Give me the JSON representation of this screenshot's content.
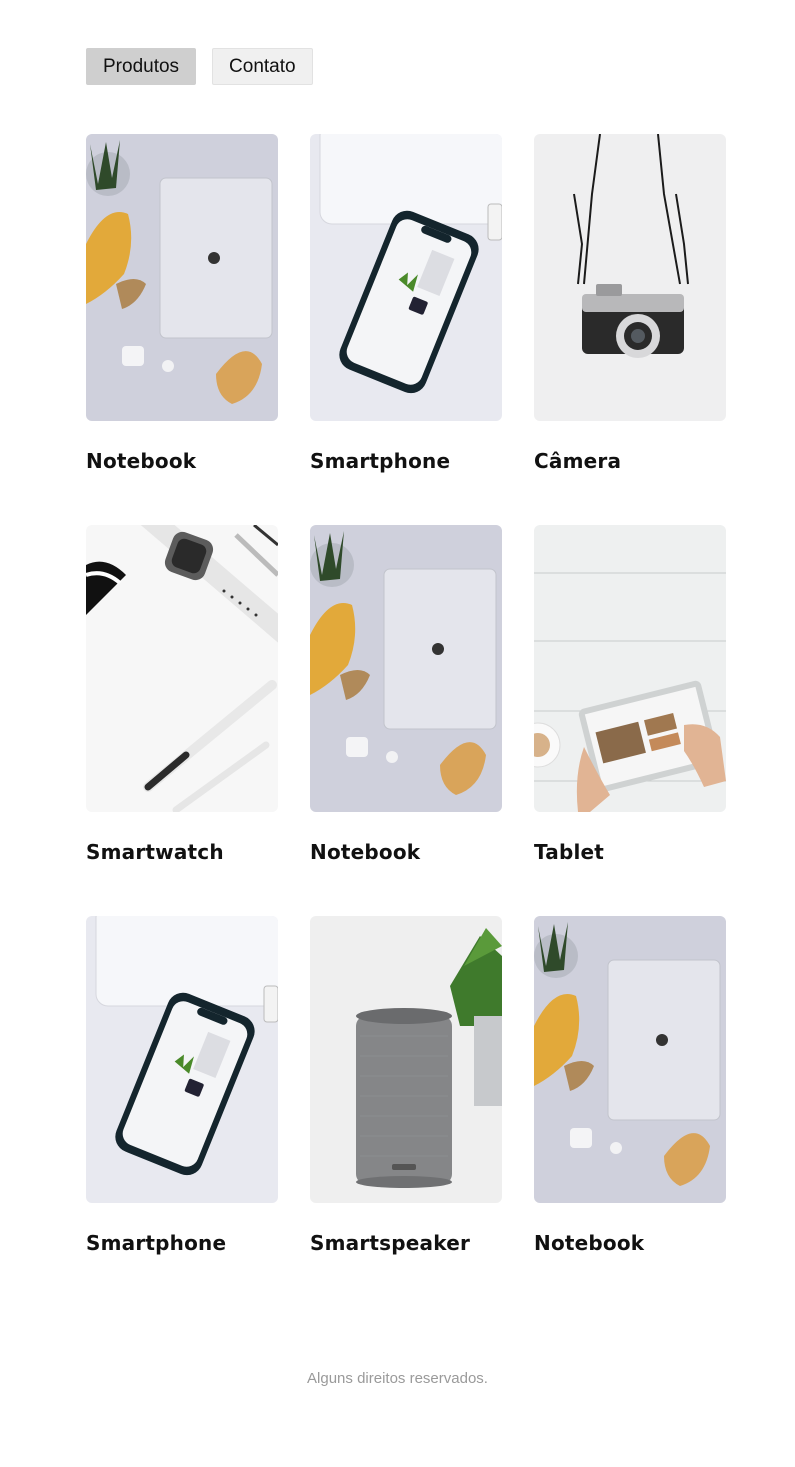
{
  "nav": {
    "items": [
      {
        "label": "Produtos",
        "active": true
      },
      {
        "label": "Contato",
        "active": false
      }
    ]
  },
  "products": [
    {
      "name": "Notebook",
      "image": "notebook-image"
    },
    {
      "name": "Smartphone",
      "image": "smartphone-image"
    },
    {
      "name": "Câmera",
      "image": "camera-image"
    },
    {
      "name": "Smartwatch",
      "image": "smartwatch-image"
    },
    {
      "name": "Notebook",
      "image": "notebook-image"
    },
    {
      "name": "Tablet",
      "image": "tablet-image"
    },
    {
      "name": "Smartphone",
      "image": "smartphone-image"
    },
    {
      "name": "Smartspeaker",
      "image": "smartspeaker-image"
    },
    {
      "name": "Notebook",
      "image": "notebook-image"
    }
  ],
  "footer": {
    "text": "Alguns direitos reservados."
  }
}
